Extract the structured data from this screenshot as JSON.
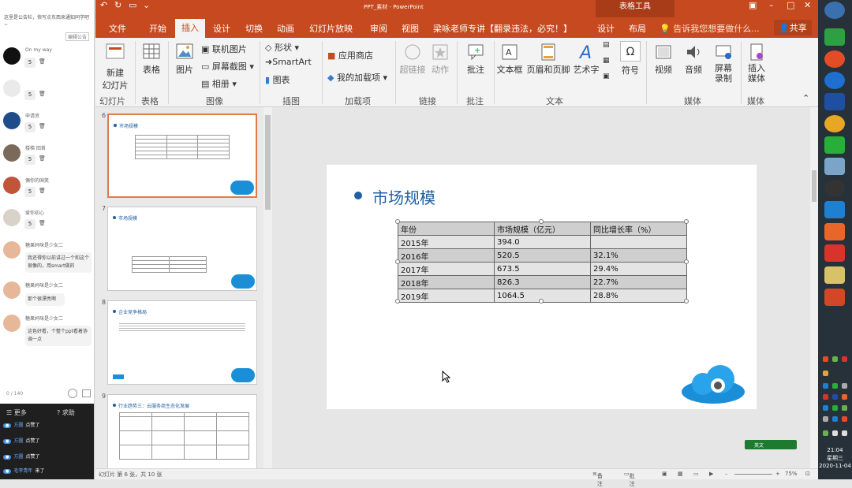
{
  "chat": {
    "notice": "这里是公告栏，快写点东西来通知同学吧~",
    "edit_notice": "编辑公告",
    "users": [
      {
        "name": "On my way",
        "count": "5"
      },
      {
        "name": "",
        "count": "5"
      },
      {
        "name": "申请资",
        "count": "5"
      },
      {
        "name": "楼梯 回首",
        "count": "5"
      },
      {
        "name": "偶你的国笑",
        "count": "5"
      },
      {
        "name": "爱你初心",
        "count": "5"
      }
    ],
    "msgs": [
      {
        "name": "糖果妈咪是少女二",
        "text": "我还得你以前讲过一个和这个很像的，用smart做的"
      },
      {
        "name": "糖果妈咪是少女二",
        "text": "那个很漂亮啊"
      },
      {
        "name": "糖果妈咪是少女二",
        "text": "这色好看，个整个ppt看着协调一点"
      }
    ],
    "counter": "0 / 140",
    "more_label": "更多",
    "help_label": "求助",
    "bottom_rows": [
      {
        "name": "方圆",
        "text": "点赞了"
      },
      {
        "name": "方圆",
        "text": "点赞了"
      },
      {
        "name": "方圆",
        "text": "点赞了"
      },
      {
        "name": "毛李青年",
        "text": "来了"
      }
    ]
  },
  "window": {
    "title": "PPT_素材 - PowerPoint",
    "contextual": "表格工具",
    "tabs": [
      "文件",
      "开始",
      "插入",
      "设计",
      "切换",
      "动画",
      "幻灯片放映",
      "审阅",
      "视图",
      "梁咏老师专讲【翻录违法，必究！】",
      "设计",
      "布局"
    ],
    "active_tab": "插入",
    "search": "告诉我您想要做什么...",
    "share": "共享"
  },
  "ribbon": {
    "new_slide": "新建\n幻灯片",
    "table": "表格",
    "picture": "图片",
    "online_pic": "联机图片",
    "screenshot": "屏幕截图",
    "album": "相册",
    "shapes": "形状",
    "smartart": "SmartArt",
    "chart": "图表",
    "store": "应用商店",
    "myaddins": "我的加载项",
    "hyperlink": "超链接",
    "action": "动作",
    "comment": "批注",
    "textbox": "文本框",
    "headerfooter": "页眉和页脚",
    "wordart": "艺术字",
    "symbol": "符号",
    "video": "视频",
    "audio": "音频",
    "screenrec": "屏幕\n录制",
    "insertmedia": "插入\n媒体",
    "groups": [
      "幻灯片",
      "表格",
      "图像",
      "插图",
      "加载项",
      "链接",
      "批注",
      "文本",
      "媒体",
      "媒体"
    ]
  },
  "thumbs": [
    {
      "num": "6",
      "title": "市场规模"
    },
    {
      "num": "7",
      "title": "市场规模"
    },
    {
      "num": "8",
      "title": "企业竞争格局"
    },
    {
      "num": "9",
      "title": "行业趋势三：云服务商生态化发展"
    }
  ],
  "slide": {
    "title": "市场规模",
    "table": {
      "headers": [
        "年份",
        "市场规模（亿元）",
        "同比增长率（%）"
      ],
      "rows": [
        [
          "2015年",
          "394.0",
          ""
        ],
        [
          "2016年",
          "520.5",
          "32.1%"
        ],
        [
          "2017年",
          "673.5",
          "29.4%"
        ],
        [
          "2018年",
          "826.3",
          "22.7%"
        ],
        [
          "2019年",
          "1064.5",
          "28.8%"
        ]
      ]
    }
  },
  "status": {
    "slide_info": "幻灯片 第 6 张，共 10 张",
    "notes": "备注",
    "comments": "批注",
    "zoom": "75%"
  },
  "ime": {
    "label": "英文"
  },
  "clock": {
    "time": "21:04",
    "weekday": "星期三",
    "date": "2020-11-04"
  },
  "colors": {
    "accent": "#c6491f",
    "title_blue": "#1f5fa5"
  }
}
